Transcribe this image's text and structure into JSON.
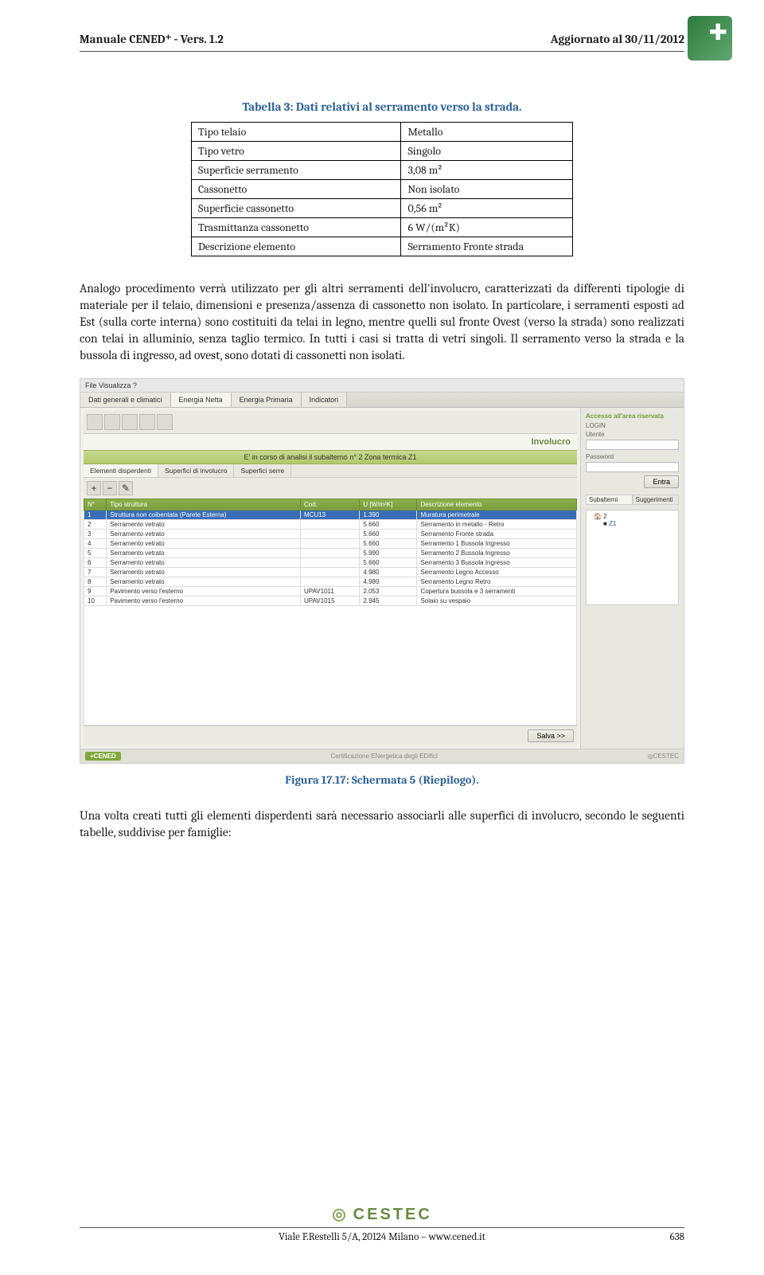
{
  "header": {
    "left": "Manuale CENED⁺ - Vers. 1.2",
    "right": "Aggiornato al 30/11/2012"
  },
  "table_caption": "Tabella 3: Dati relativi al serramento verso la strada.",
  "table_rows": [
    {
      "k": "Tipo telaio",
      "v": "Metallo"
    },
    {
      "k": "Tipo vetro",
      "v": "Singolo"
    },
    {
      "k": "Superficie serramento",
      "v": "3,08 m²"
    },
    {
      "k": "Cassonetto",
      "v": "Non isolato"
    },
    {
      "k": "Superficie cassonetto",
      "v": "0,56 m²"
    },
    {
      "k": "Trasmittanza cassonetto",
      "v": "6 W/(m²K)"
    },
    {
      "k": "Descrizione elemento",
      "v": "Serramento Fronte strada"
    }
  ],
  "para1": "Analogo procedimento verrà utilizzato per gli altri serramenti dell'involucro, caratterizzati da differenti tipologie di materiale per il telaio, dimensioni e presenza/assenza di cassonetto non isolato. In particolare, i serramenti esposti ad Est (sulla corte interna) sono costituiti da telai in legno, mentre quelli sul fronte Ovest (verso la strada) sono realizzati con telai in alluminio, senza taglio termico. In tutti i casi si tratta di vetri singoli. Il serramento verso la strada e la bussola di ingresso, ad ovest, sono dotati di cassonetti non isolati.",
  "screenshot": {
    "menu": "File  Visualizza  ?",
    "main_tabs": [
      "Dati generali e climatici",
      "Energia Netta",
      "Energia Primaria",
      "Indicatori"
    ],
    "banner": "Involucro",
    "status": "E' in corso di analisi il subalterno n°  2        Zona termica  Z1",
    "sub_tabs": [
      "Elementi disperdenti",
      "Superfici di involucro",
      "Superfici serre"
    ],
    "grid_headers": [
      "N°",
      "Tipo struttura",
      "Cod.",
      "U [W/m²K]",
      "Descrizione elemento"
    ],
    "grid_rows": [
      {
        "n": "1",
        "tipo": "Struttura non coibentata (Parete Esterna)",
        "cod": "MCU13",
        "u": "1.390",
        "desc": "Muratura perimetrale",
        "sel": true
      },
      {
        "n": "2",
        "tipo": "Serramento vetrato",
        "cod": "",
        "u": "5.660",
        "desc": "Serramento in metallo - Retro"
      },
      {
        "n": "3",
        "tipo": "Serramento vetrato",
        "cod": "",
        "u": "5.660",
        "desc": "Serramento Fronte strada"
      },
      {
        "n": "4",
        "tipo": "Serramento vetrato",
        "cod": "",
        "u": "5.660",
        "desc": "Serramento 1 Bussola Ingresso"
      },
      {
        "n": "5",
        "tipo": "Serramento vetrato",
        "cod": "",
        "u": "5.990",
        "desc": "Serramento 2 Bussola Ingresso"
      },
      {
        "n": "6",
        "tipo": "Serramento vetrato",
        "cod": "",
        "u": "5.660",
        "desc": "Serramento 3 Bussola Ingresso"
      },
      {
        "n": "7",
        "tipo": "Serramento vetrato",
        "cod": "",
        "u": "4.980",
        "desc": "Serramento Legno Accesso"
      },
      {
        "n": "8",
        "tipo": "Serramento vetrato",
        "cod": "",
        "u": "4.980",
        "desc": "Serramento Legno Retro"
      },
      {
        "n": "9",
        "tipo": "Pavimento verso l'esterno",
        "cod": "UPAV1011",
        "u": "2.053",
        "desc": "Copertura bussola e 3 serramenti"
      },
      {
        "n": "10",
        "tipo": "Pavimento verso l'esterno",
        "cod": "UPAV1015",
        "u": "2.945",
        "desc": "Solaio su vespaio"
      }
    ],
    "salva_btn": "Salva  >>",
    "side": {
      "area_riservata": "Accesso all'area riservata",
      "login_label": "LOGIN",
      "utente_label": "Utente",
      "password_label": "Password",
      "entra_btn": "Entra",
      "tabs": [
        "Subalterni",
        "Suggerimenti"
      ],
      "tree_root": "2",
      "tree_child": "Z1"
    },
    "bottom_brand": "+CENED",
    "bottom_center": "Certificazione ENergetica degli EDifici",
    "bottom_right": "◎CESTEC"
  },
  "fig_caption": "Figura 17.17: Schermata 5 (Riepilogo).",
  "para2": "Una volta creati tutti gli elementi disperdenti sarà necessario associarli alle superfici di involucro, secondo le seguenti tabelle, suddivise per famiglie:",
  "footer": {
    "brand": "CESTEC",
    "address": "Viale F.Restelli 5/A, 20124 Milano – www.cened.it",
    "page": "638"
  }
}
